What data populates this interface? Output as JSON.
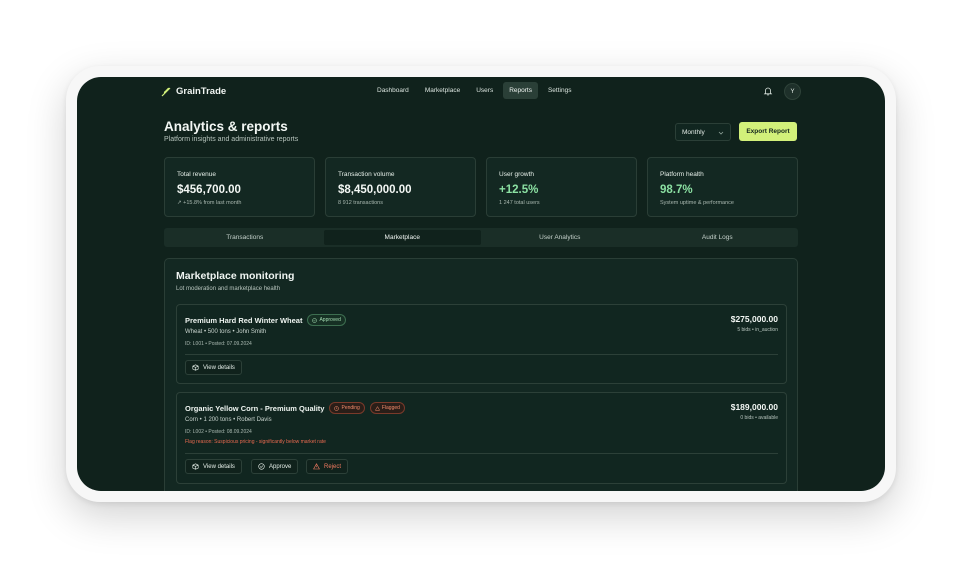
{
  "app": {
    "brand": "GrainTrade",
    "user_initial": "Y"
  },
  "nav": [
    {
      "label": "Dashboard",
      "active": false
    },
    {
      "label": "Marketplace",
      "active": false
    },
    {
      "label": "Users",
      "active": false
    },
    {
      "label": "Reports",
      "active": true
    },
    {
      "label": "Settings",
      "active": false
    }
  ],
  "header": {
    "title": "Analytics & reports",
    "subtitle": "Platform insights and administrative reports",
    "period": "Monthly",
    "export_label": "Export Report"
  },
  "stats": [
    {
      "label": "Total revenue",
      "value": "$456,700.00",
      "sub": "↗ +15.8% from last month"
    },
    {
      "label": "Transaction volume",
      "value": "$8,450,000.00",
      "sub": "8 912 transactions"
    },
    {
      "label": "User growth",
      "value": "+12.5%",
      "sub": "1 247 total users"
    },
    {
      "label": "Platform health",
      "value": "98.7%",
      "sub": "System uptime & performance"
    }
  ],
  "tabs": [
    {
      "label": "Transactions",
      "active": false
    },
    {
      "label": "Marketplace",
      "active": true
    },
    {
      "label": "User Analytics",
      "active": false
    },
    {
      "label": "Audit Logs",
      "active": false
    }
  ],
  "panel": {
    "title": "Marketplace monitoring",
    "subtitle": "Lot moderation and marketplace health",
    "lots": [
      {
        "title": "Premium Hard Red Winter Wheat",
        "status": "Approved",
        "meta": "Wheat • 500 tons • John Smith",
        "id_line": "ID: L001 • Posted: 07.09.2024",
        "price": "$275,000.00",
        "bids": "5 bids • in_auction",
        "view_label": "View details"
      },
      {
        "title": "Organic Yellow Corn - Premium Quality",
        "status": "Pending",
        "flag_badge": "Flagged",
        "meta": "Corn • 1 200 tons • Robert Davis",
        "id_line": "ID: L002 • Posted: 08.09.2024",
        "flag_reason": "Flag reason: Suspicious pricing - significantly below market rate",
        "price": "$189,000.00",
        "bids": "0 bids • available",
        "view_label": "View details",
        "approve_label": "Approve",
        "reject_label": "Reject"
      }
    ]
  },
  "colors": {
    "accent": "#d2f07a",
    "background": "#10221c",
    "positive": "#8be0a2",
    "danger": "#f07a60"
  }
}
